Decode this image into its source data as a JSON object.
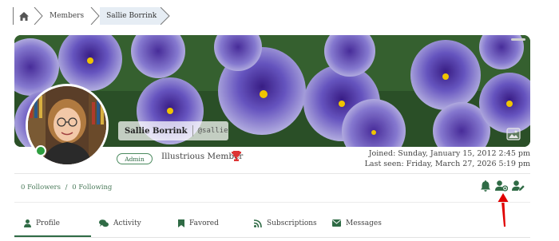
{
  "breadcrumb": {
    "items": [
      "Members",
      "Sallie Borrink"
    ]
  },
  "profile": {
    "name": "Sallie Borrink",
    "handle": "@sallie",
    "role": "Admin",
    "rank": "Illustrious Member",
    "joined": "Joined: Sunday, January 15, 2012 2:45 pm",
    "last_seen": "Last seen: Friday, March 27, 2026 5:19 pm",
    "status": "online"
  },
  "stats": {
    "followers": "0 Followers",
    "separator": "/",
    "following": "0 Following"
  },
  "actions": {
    "icons": [
      "bell-icon",
      "follow-user-icon",
      "edit-user-icon"
    ]
  },
  "tabs": [
    {
      "label": "Profile",
      "icon": "user-icon",
      "active": true
    },
    {
      "label": "Activity",
      "icon": "comments-icon"
    },
    {
      "label": "Favored",
      "icon": "bookmark-icon"
    },
    {
      "label": "Subscriptions",
      "icon": "rss-icon"
    },
    {
      "label": "Messages",
      "icon": "envelope-icon"
    }
  ],
  "colors": {
    "accent_green": "#2f6b45",
    "trophy_red": "#d33",
    "arrow_red": "#e00000",
    "breadcrumb_current_bg": "#e6edf4"
  }
}
